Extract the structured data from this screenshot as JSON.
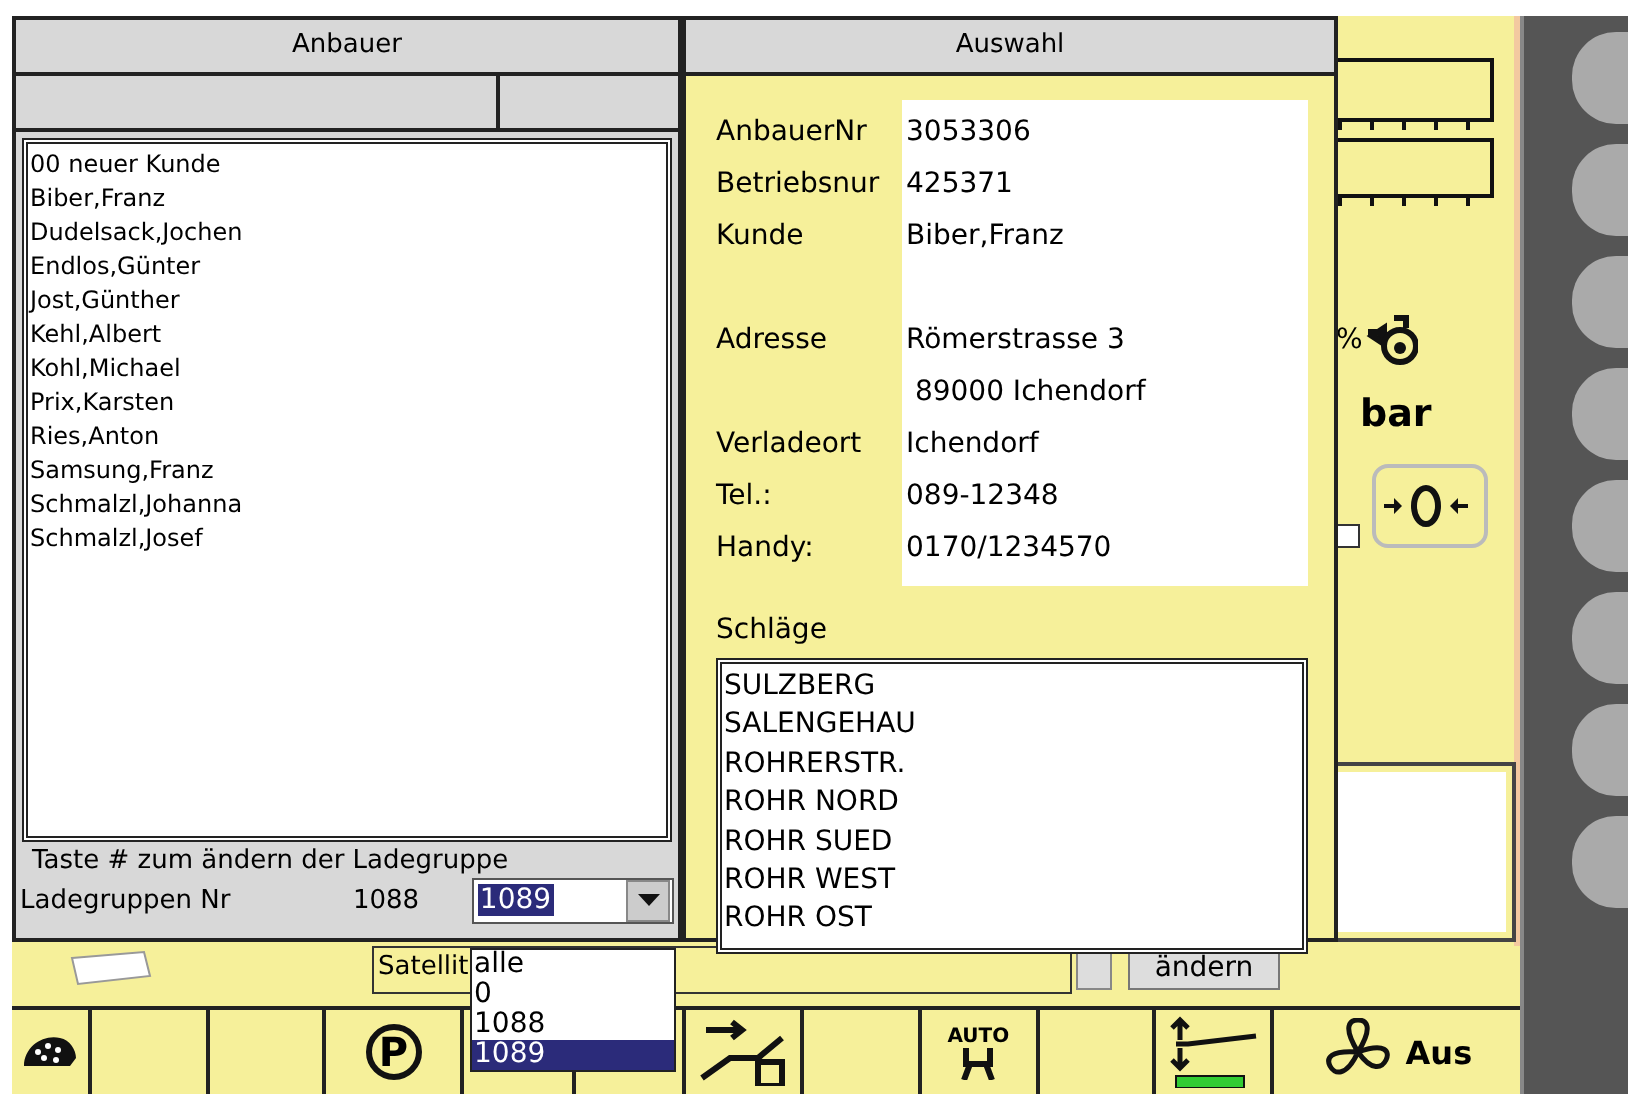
{
  "anbauer": {
    "title": "Anbauer",
    "customers": [
      {
        "name": "00 neuer Kunde"
      },
      {
        "name": "Biber,Franz"
      },
      {
        "name": "Dudelsack,Jochen"
      },
      {
        "name": "Endlos,Günter"
      },
      {
        "name": "Jost,Günther"
      },
      {
        "name": "Kehl,Albert"
      },
      {
        "name": "Kohl,Michael"
      },
      {
        "name": "Prix,Karsten"
      },
      {
        "name": "Ries,Anton"
      },
      {
        "name": "Samsung,Franz"
      },
      {
        "name": "Schmalzl,Johanna"
      },
      {
        "name": "Schmalzl,Josef"
      }
    ],
    "hint": "Taste # zum ändern der Ladegruppe",
    "group_label": "Ladegruppen Nr",
    "group_current": "1088",
    "group_select": {
      "value": "1089",
      "expanded": true,
      "options": [
        {
          "label": "alle",
          "selected": false
        },
        {
          "label": "0",
          "selected": false
        },
        {
          "label": "1088",
          "selected": false
        },
        {
          "label": "1089",
          "selected": true
        }
      ]
    }
  },
  "auswahl": {
    "title": "Auswahl",
    "field_groups": [
      [
        {
          "label": "AnbauerNr",
          "value": "3053306"
        },
        {
          "label": "Betriebsnur",
          "value": "425371"
        },
        {
          "label": "Kunde",
          "value": "Biber,Franz"
        }
      ],
      [
        {
          "label": "Adresse",
          "value": "Römerstrasse 3"
        },
        {
          "value": " 89000 Ichendorf"
        },
        {
          "label": "Verladeort",
          "value": "Ichendorf"
        },
        {
          "label": "Tel.:",
          "value": "089-12348"
        },
        {
          "label": "Handy:",
          "value": "0170/1234570"
        }
      ]
    ],
    "plots_label": "Schläge",
    "plots": [
      {
        "name": "SULZBERG"
      },
      {
        "name": "SALENGEHAU"
      },
      {
        "name": "ROHRERSTR."
      },
      {
        "name": "ROHR NORD"
      },
      {
        "name": "ROHR SUED"
      },
      {
        "name": "ROHR WEST"
      },
      {
        "name": "ROHR OST"
      }
    ]
  },
  "background": {
    "checkbox": {
      "checked": false
    },
    "percent": "%",
    "unit": "bar",
    "satellite_button": "Satellit",
    "change_button": "ändern",
    "toolbar": [
      {
        "kind": "hedgehog"
      },
      {
        "kind": "blank"
      },
      {
        "kind": "blank"
      },
      {
        "kind": "parking",
        "text": "P"
      },
      {
        "kind": "blank"
      },
      {
        "kind": "blank"
      },
      {
        "kind": "arm"
      },
      {
        "kind": "blank"
      },
      {
        "kind": "auto",
        "text": "AUTO"
      },
      {
        "kind": "blank"
      },
      {
        "kind": "lift"
      },
      {
        "kind": "fan",
        "text": "Aus"
      }
    ]
  }
}
